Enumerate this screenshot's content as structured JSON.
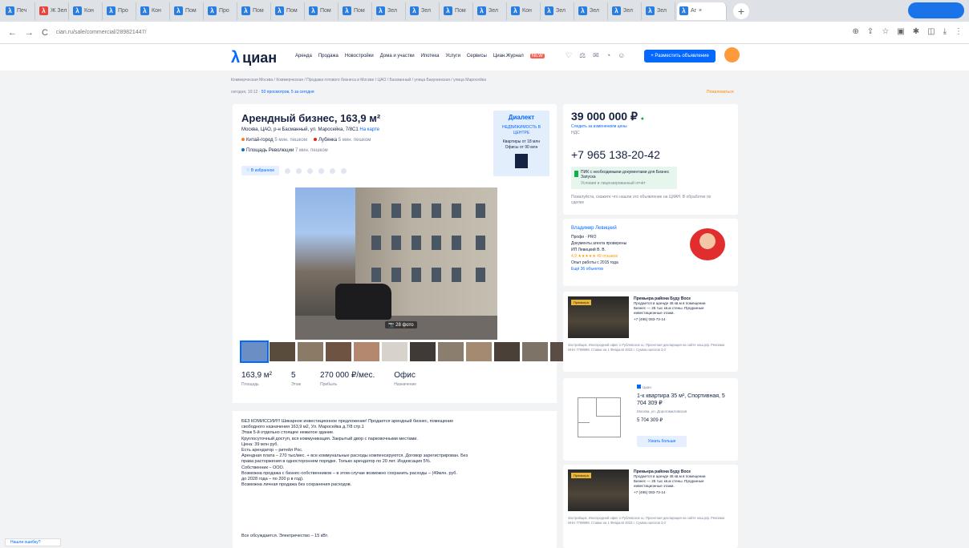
{
  "browser": {
    "tabs": [
      "Печ",
      "Ж Зел",
      "Кон",
      "Про",
      "Кон",
      "Пом",
      "Про",
      "Пом",
      "Пом",
      "Пом",
      "Пом",
      "Зел",
      "Зел",
      "Пом",
      "Зел",
      "Кон",
      "Зел",
      "Зел",
      "Зел",
      "Зел"
    ],
    "active_tab": "Ar",
    "new_tab": "+",
    "profile": "",
    "url": "cian.ru/sale/commercial/289821447/",
    "nav_back": "←",
    "nav_forward": "→",
    "reload": "C"
  },
  "header": {
    "logo": "циан",
    "nav": [
      "Аренда",
      "Продажа",
      "Новостройки",
      "Дома и участки",
      "Ипотека",
      "Услуги",
      "Сервисы",
      "Циан.Журнал"
    ],
    "promo": "NEW",
    "place_button": "+ Разместить объявление"
  },
  "breadcrumbs": "Коммерческая Москва  /  Коммерческая  /  Продажа готового бизнеса в Москве  /  ЦАО  /  Басманный  /  улица Бакунинская  /  улица Маросейка",
  "breadcrumbs2": {
    "date": "сегодня, 10:12",
    "views": "50 просмотров, 5 за сегодня"
  },
  "complain": "Пожаловаться",
  "listing": {
    "title": "Арендный бизнес, 163,9 м²",
    "address": "Москва, ЦАО, р-н Басманный, ул. Маросейка, 7/8С1",
    "address_link": "На карте",
    "metro": [
      {
        "name": "Китай-город",
        "time": "5 мин. пешком",
        "color": "#f58025"
      },
      {
        "name": "Лубянка",
        "time": "5 мин. пешком",
        "color": "#e42313"
      }
    ],
    "metro2": {
      "name": "Площадь Революции",
      "time": "7 мин. пешком",
      "color": "#0078be"
    },
    "favorite": "В избранное",
    "ad": {
      "brand": "Диалект",
      "title": "НЕДВИЖИМОСТЬ В ЦЕНТРЕ",
      "sub": "Квартиры от 18 млн",
      "sub2": "Офисы от 90 млн"
    },
    "photo_count": "28 фото",
    "facts": [
      {
        "value": "163,9 м²",
        "label": "Площадь"
      },
      {
        "value": "5",
        "label": "Этаж"
      },
      {
        "value": "270 000 ₽/мес.",
        "label": "Прибыль"
      },
      {
        "value": "Офис",
        "label": "Назначение"
      }
    ],
    "description": [
      "БЕЗ КОМИССИИ!!! Шикарное инвестиционное предложение! Продается арендный бизнес, помещение",
      "свободного назначения 163,9 м2, Ул. Маросейка д.7/8 стр.1",
      "Этаж 5-й отдельно стоящее нежилое здание.",
      "Круглосуточный доступ, вся коммуникация. Закрытый двор с парковочными местами.",
      "Цена: 39 млн руб.",
      "Есть арендатор – ритейл Рос.",
      "Арендная плата – 270 тыс/мес. + все коммунальные расходы компенсируются. Договор зарегистрирован. Без",
      "права расторжения в одностороннем порядке. Только арендатор по 20 лет. Индексация 5%.",
      "Собственник – ООО.",
      "Возможна продажа с бизнес-собственников – в этом случае возможно сохранить расходы – (49млн. руб.",
      "до 2028 года – по 200 р в год).",
      "Возможна личная продажа без сохранения расходов."
    ],
    "desc_footer": "Все обсуждается. Электричество – 15 кВт."
  },
  "sidebar": {
    "price": "39 000 000 ₽",
    "price_note": "Следить за изменением цены",
    "price_note2": "НДС",
    "phone": "+7 965 138-20-42",
    "promo": "ПИК с необходимыми документами для Бизнес Запуска",
    "promo2": "Условия и лицензированный отчёт",
    "footer": "Пожалуйста, скажите что нашли это объявление на ЦИАН. В обработке по сделке",
    "agent": {
      "name": "Владимир Левицкий",
      "lines": [
        "Профи · PRO",
        "Документы агента проверены",
        "ИП Левицкий В. В.",
        "4,9 ★★★★★ 49 отзывов",
        "Опыт работы с 2015 года",
        "Ещё 36 объектов"
      ]
    },
    "card1": {
      "tag": "Премьера",
      "title": "Премьера района Буду Восе",
      "lines": [
        "Продается в аренде 46 кв.м в помещении",
        "Бизнес — 25 тыс кв.м стены. Проданные",
        "инвестиционные этажи."
      ],
      "phone": "+7 (495) 083-73-14",
      "foot": "Застройщик. Иногородний офис 1 Рублевское ш. Проектная декларация на сайте наш.рф. Реклама ИНН 7799999. Ставки на 1 Февраля 2023 г. Сумма налогов 3,0"
    },
    "flat": {
      "badge": "Циан",
      "title": "1-к квартира 35 м², Спортивная, 5 704 309 ₽",
      "sub": "Москва, ул. Дорогомиловская",
      "price": "5 704 309 ₽",
      "btn": "Узнать больше"
    },
    "card2": {
      "tag": "Премьера",
      "title": "Премьера района Буду Восе",
      "lines": [
        "Продается в аренде 46 кв.м в помещении",
        "Бизнес — 25 тыс кв.м стены. Проданные",
        "инвестиционные этажи."
      ],
      "phone": "+7 (495) 083-73-14",
      "foot": "Застройщик. Иногородний офис 1 Рублевское ш. Проектная декларация на сайте наш.рф. Реклама ИНН 7799999. Ставки на 1 Февраля 2023 г. Сумма налогов 3,0"
    }
  },
  "bottom_tag": "Нашли ошибку?"
}
